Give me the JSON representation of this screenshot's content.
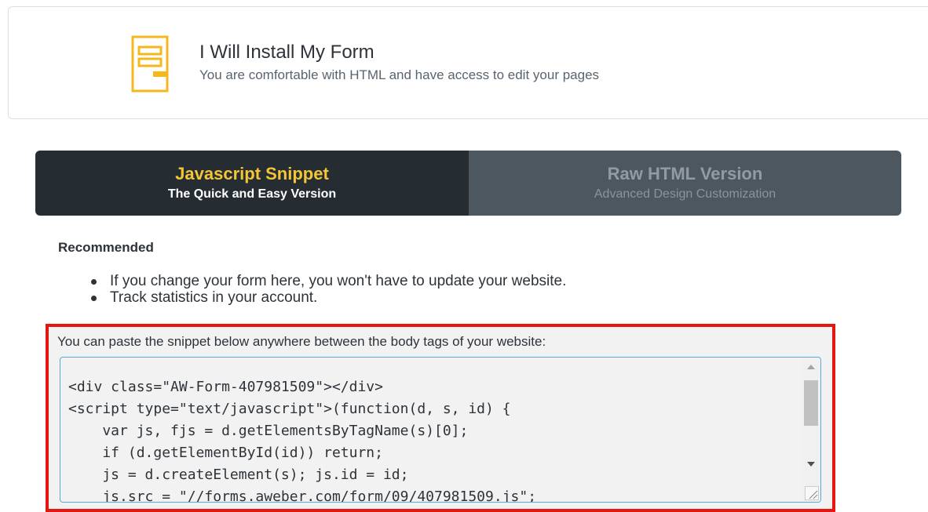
{
  "install_option": {
    "title": "I Will Install My Form",
    "subtitle": "You are comfortable with HTML and have access to edit your pages",
    "icon": "form-layout-icon"
  },
  "tabs": [
    {
      "title": "Javascript Snippet",
      "subtitle": "The Quick and Easy Version",
      "active": true
    },
    {
      "title": "Raw HTML Version",
      "subtitle": "Advanced Design Customization",
      "active": false
    }
  ],
  "recommended": {
    "heading": "Recommended",
    "bullets": [
      "If you change your form here, you won't have to update your website.",
      "Track statistics in your account."
    ]
  },
  "snippet": {
    "label": "You can paste the snippet below anywhere between the body tags of your website:",
    "lines": [
      "<div class=\"AW-Form-407981509\"></div>",
      "<script type=\"text/javascript\">(function(d, s, id) {",
      "    var js, fjs = d.getElementsByTagName(s)[0];",
      "    if (d.getElementById(id)) return;",
      "    js = d.createElement(s); js.id = id;",
      "    js.src = \"//forms.aweber.com/form/09/407981509.js\";"
    ]
  },
  "colors": {
    "accent": "#f4c534",
    "highlight_border": "#e4160f",
    "active_tab": "#252d33",
    "inactive_tab": "#4d5760"
  }
}
